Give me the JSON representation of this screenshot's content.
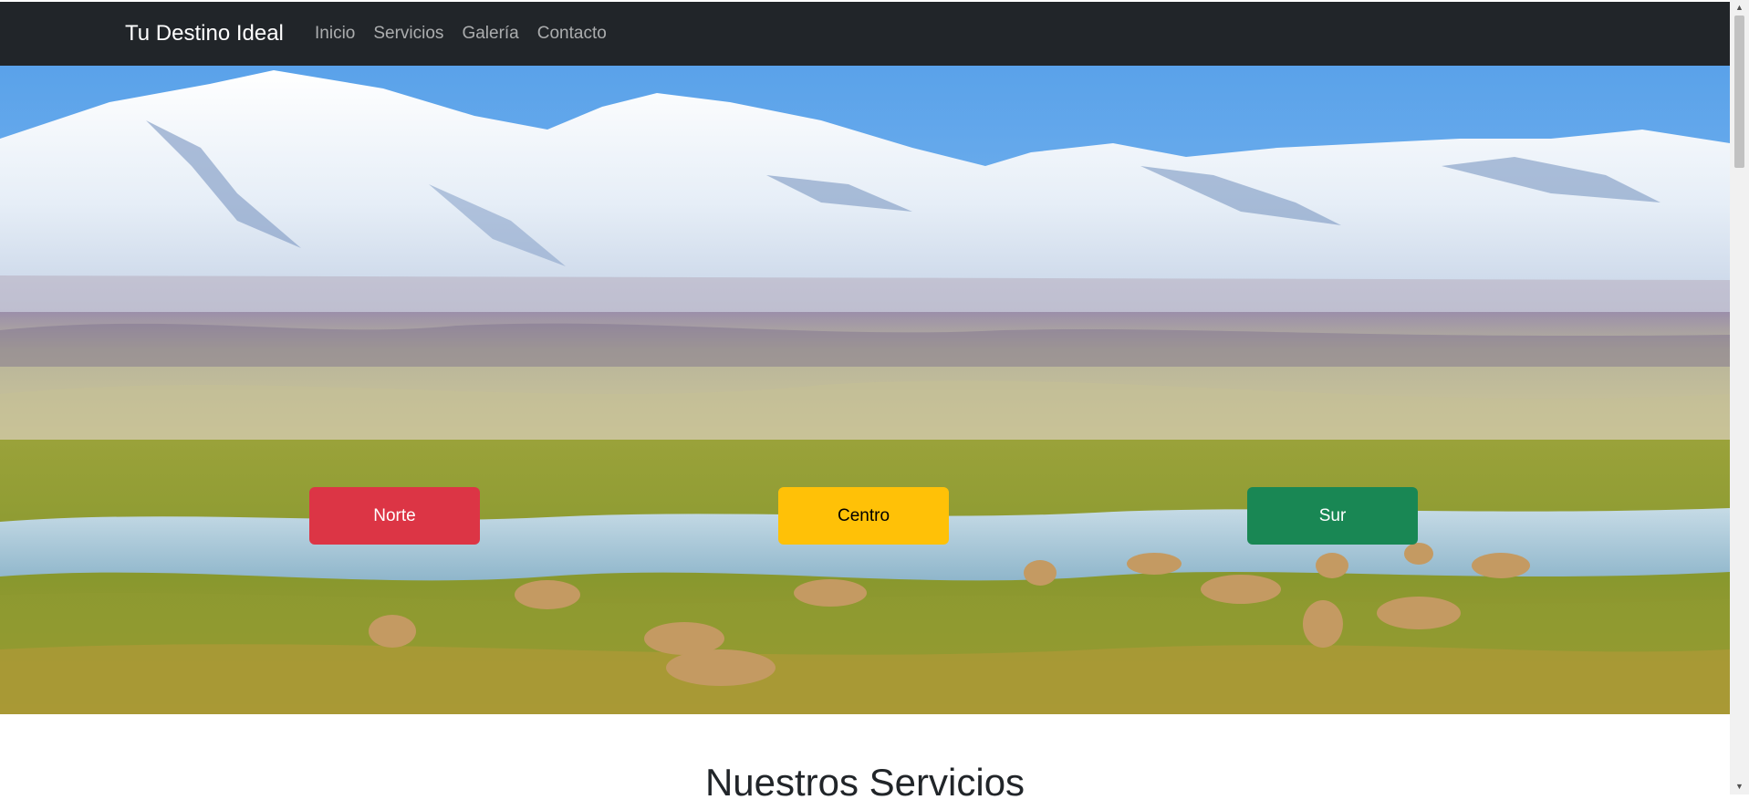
{
  "navbar": {
    "brand": "Tu Destino Ideal",
    "links": [
      {
        "label": "Inicio"
      },
      {
        "label": "Servicios"
      },
      {
        "label": "Galería"
      },
      {
        "label": "Contacto"
      }
    ]
  },
  "hero": {
    "image_icon": "landscape-photo-mountains-vicunas",
    "buttons": {
      "norte": "Norte",
      "centro": "Centro",
      "sur": "Sur"
    }
  },
  "services": {
    "title": "Nuestros Servicios"
  },
  "colors": {
    "navbar_bg": "#212529",
    "norte": "#dc3545",
    "centro": "#ffc107",
    "sur": "#198754"
  }
}
